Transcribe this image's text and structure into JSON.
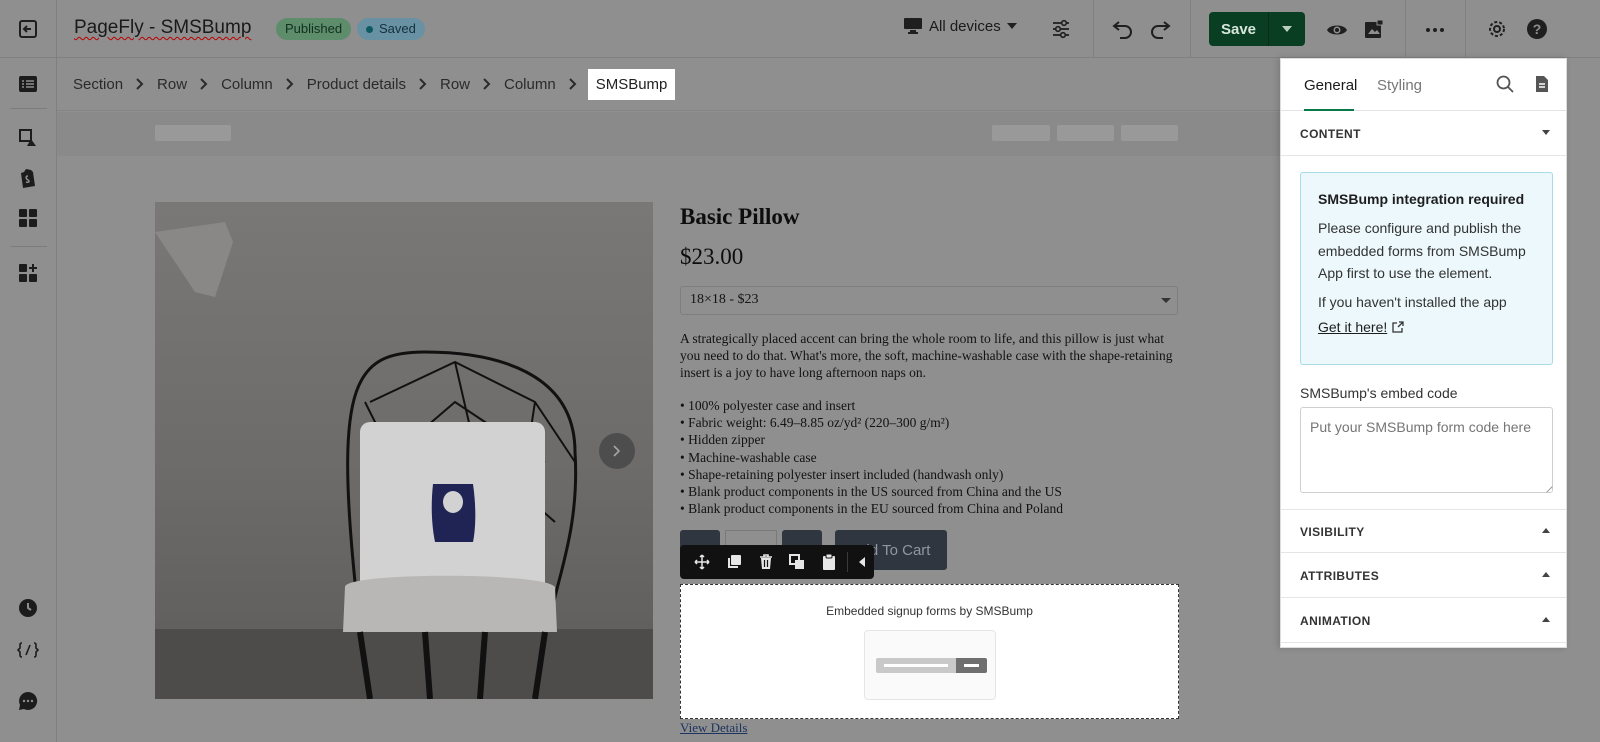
{
  "header": {
    "title": "PageFly - SMSBump",
    "published_badge": "Published",
    "saved_badge": "Saved",
    "devices_label": "All devices",
    "save_label": "Save"
  },
  "breadcrumb": {
    "items": [
      "Section",
      "Row",
      "Column",
      "Product details",
      "Row",
      "Column"
    ],
    "active": "SMSBump"
  },
  "product": {
    "title": "Basic Pillow",
    "price": "$23.00",
    "variant": "18×18 - $23",
    "description": "A strategically placed accent can bring the whole room to life, and this pillow is just what you need to do that. What's more, the soft, machine-washable case with the shape-retaining insert is a joy to have long afternoon naps on.",
    "features": [
      "• 100% polyester case and insert",
      "• Fabric weight: 6.49–8.85 oz/yd² (220–300 g/m²)",
      "• Hidden zipper",
      "• Machine-washable case",
      "• Shape-retaining polyester insert included (handwash only)",
      "• Blank product components in the US sourced from China and the US",
      "• Blank product components in the EU sourced from China and Poland"
    ],
    "add_to_cart": "Add To Cart",
    "view_details": "View Details"
  },
  "embed": {
    "label": "Embedded signup forms by SMSBump"
  },
  "panel": {
    "tab_general": "General",
    "tab_styling": "Styling",
    "content_heading": "CONTENT",
    "notice_title": "SMSBump integration required",
    "notice_body": "Please configure and publish the embedded forms from SMSBump App first to use the element.",
    "notice_hint": "If you haven't installed the app",
    "notice_link": "Get it here!",
    "embed_code_label": "SMSBump's embed code",
    "embed_code_placeholder": "Put your SMSBump form code here",
    "visibility_heading": "VISIBILITY",
    "attributes_heading": "ATTRIBUTES",
    "animation_heading": "ANIMATION"
  },
  "colors": {
    "save_green": "#093e22",
    "tab_accent": "#087a4a",
    "notice_bg": "#ecf8fb"
  }
}
